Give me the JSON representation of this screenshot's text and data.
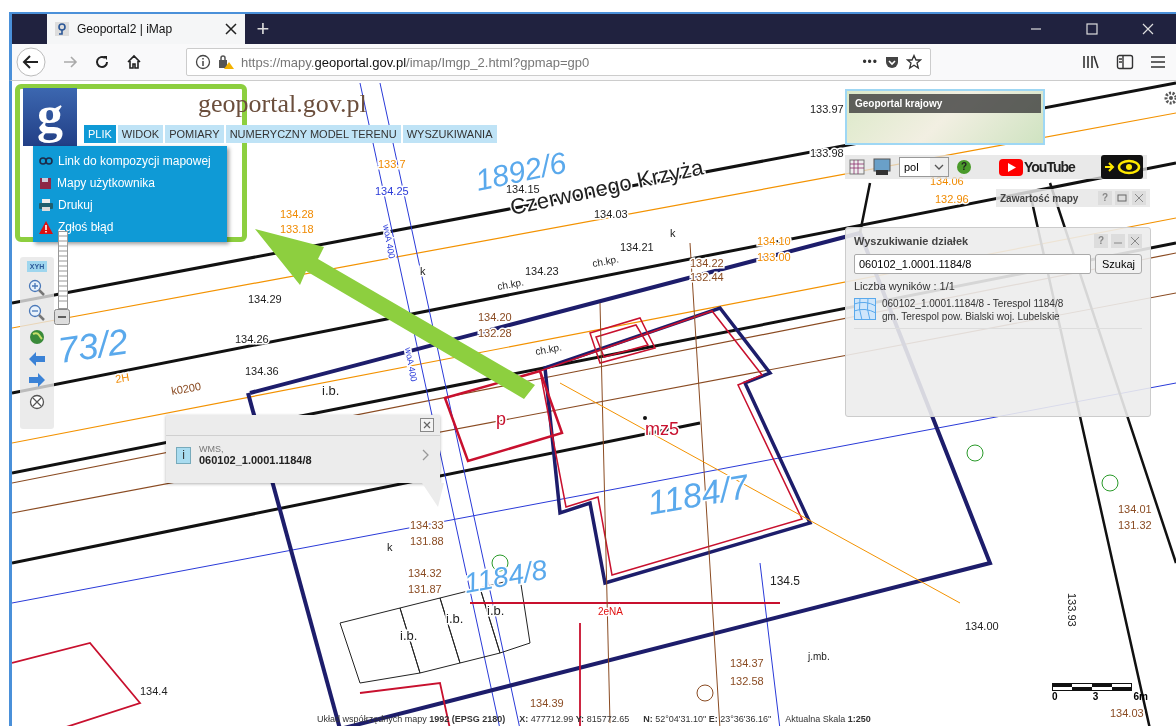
{
  "browser": {
    "tab_title": "Geoportal2 | iMap",
    "new_tab": "+",
    "url_prefix": "https://mapy.",
    "url_domain": "geoportal.gov.pl",
    "url_path": "/imap/Imgp_2.html?gpmap=gp0",
    "page_actions": "•••"
  },
  "header": {
    "logo_letter": "g",
    "site_name": "geoportal.gov.pl"
  },
  "menu_tabs": [
    {
      "label": "PLIK",
      "selected": true
    },
    {
      "label": "WIDOK",
      "selected": false
    },
    {
      "label": "POMIARY",
      "selected": false
    },
    {
      "label": "NUMERYCZNY MODEL TERENU",
      "selected": false
    },
    {
      "label": "WYSZUKIWANIA",
      "selected": false
    }
  ],
  "file_menu": [
    {
      "kind": "link",
      "label": "Link do kompozycji mapowej"
    },
    {
      "kind": "maps",
      "label": "Mapy użytkownika"
    },
    {
      "kind": "print",
      "label": "Drukuj"
    },
    {
      "kind": "error",
      "label": "Zgłoś błąd"
    }
  ],
  "nav_tools": {
    "xyh": "XYH"
  },
  "map_labels": [
    {
      "kind": "street",
      "text": "Czerwonego Krzyża"
    },
    {
      "kind": "parcel",
      "text": "1892/6"
    },
    {
      "kind": "parcel",
      "text": "73/2"
    },
    {
      "kind": "parcel",
      "text": "1184/7"
    },
    {
      "kind": "parcel",
      "text": "1184/8"
    },
    {
      "kind": "building",
      "text": "mz5"
    },
    {
      "kind": "building",
      "text": "p"
    },
    {
      "kind": "height",
      "text": "134.5"
    },
    {
      "kind": "height",
      "text": "i.b."
    },
    {
      "kind": "height",
      "text": "i.b."
    },
    {
      "kind": "height",
      "text": "i.b."
    },
    {
      "kind": "height",
      "text": "i.b."
    },
    {
      "kind": "height",
      "text": "134.15"
    },
    {
      "kind": "height",
      "text": "134.03"
    },
    {
      "kind": "height",
      "text": "134.21"
    },
    {
      "kind": "height",
      "text": "134.23"
    },
    {
      "kind": "height",
      "text": "134.29"
    },
    {
      "kind": "height",
      "text": "134.26"
    },
    {
      "kind": "height",
      "text": "134.36"
    },
    {
      "kind": "height",
      "text": "134.4"
    },
    {
      "kind": "utility",
      "text": "134.33"
    },
    {
      "kind": "utility",
      "text": "131.88"
    },
    {
      "kind": "utility",
      "text": "134.32"
    },
    {
      "kind": "utility",
      "text": "131.87"
    },
    {
      "kind": "utility",
      "text": "134.39"
    },
    {
      "kind": "utility",
      "text": "134.37"
    },
    {
      "kind": "utility",
      "text": "132.58"
    },
    {
      "kind": "utility",
      "text": "134.22"
    },
    {
      "kind": "utility",
      "text": "132.44"
    },
    {
      "kind": "utility",
      "text": "134.20"
    },
    {
      "kind": "utility",
      "text": "132.28"
    },
    {
      "kind": "orange",
      "text": "134.10"
    },
    {
      "kind": "orange",
      "text": "133.00"
    },
    {
      "kind": "orange",
      "text": "134.28"
    },
    {
      "kind": "orange",
      "text": "133.18"
    },
    {
      "kind": "orange",
      "text": "133.7"
    },
    {
      "kind": "orange",
      "text": "134.06"
    },
    {
      "kind": "orange",
      "text": "132.96"
    },
    {
      "kind": "water",
      "text": "134.25"
    },
    {
      "kind": "height",
      "text": "133.97"
    },
    {
      "kind": "height",
      "text": "133.98"
    },
    {
      "kind": "height",
      "text": "ch.kp."
    },
    {
      "kind": "height",
      "text": "ch.kp."
    },
    {
      "kind": "height",
      "text": "ch.kp."
    },
    {
      "kind": "height",
      "text": "j.mb."
    },
    {
      "kind": "height",
      "text": "134.00"
    },
    {
      "kind": "height",
      "text": "133.93"
    },
    {
      "kind": "utility",
      "text": "134.01"
    },
    {
      "kind": "utility",
      "text": "131.32"
    },
    {
      "kind": "utility",
      "text": "134.03"
    },
    {
      "kind": "height",
      "text": "k"
    },
    {
      "kind": "height",
      "text": "k"
    },
    {
      "kind": "height",
      "text": "k"
    },
    {
      "kind": "utility",
      "text": "k0200"
    },
    {
      "kind": "orange",
      "text": "2H"
    },
    {
      "kind": "redline",
      "text": "2eNA"
    },
    {
      "kind": "water",
      "text": "woA 400"
    },
    {
      "kind": "water",
      "text": "woA 400"
    }
  ],
  "popup": {
    "info_badge": "i",
    "source": "WMS,",
    "parcel_id": "060102_1.0001.1184/8"
  },
  "overview": {
    "title": "Geoportal krajowy"
  },
  "toolbar": {
    "language": "pol",
    "help": "?",
    "video": "YouTube"
  },
  "map_content_panel": {
    "title": "Zawartość mapy",
    "help": "?"
  },
  "search_panel": {
    "title": "Wyszukiwanie działek",
    "help": "?",
    "query": "060102_1.0001.1184/8",
    "button": "Szukaj",
    "count": "Liczba wyników : 1/1",
    "results": [
      {
        "line1": "060102_1.0001.1184/8 - Terespol 1184/8",
        "line2": "gm. Terespol pow. Bialski woj. Lubelskie"
      }
    ]
  },
  "scale_bar": {
    "ticks": [
      "0",
      "3",
      "6m"
    ]
  },
  "status_bar": [
    "Układ współrzędnych mapy **1992 (EPSG 2180)**",
    "**X:** 477712.99 **Y:** 815772.65",
    "**N:** 52°04'31.10\" **E:** 23°36'36.16\"",
    "Aktualna Skala **1:250**"
  ]
}
